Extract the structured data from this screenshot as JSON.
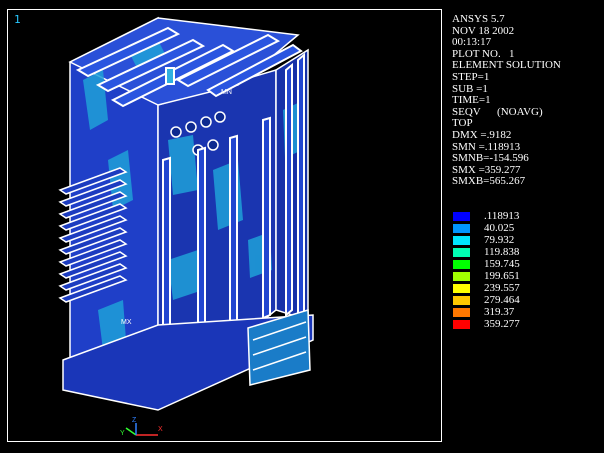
{
  "window_number": "1",
  "info_lines": [
    "ANSYS 5.7",
    "NOV 18 2002",
    "00:13:17",
    "PLOT NO.   1",
    "ELEMENT SOLUTION",
    "STEP=1",
    "SUB =1",
    "TIME=1",
    "SEQV      (NOAVG)",
    "TOP",
    "DMX =.9182",
    "SMN =.118913",
    "SMNB=-154.596",
    "SMX =359.277",
    "SMXB=565.267"
  ],
  "legend": [
    {
      "label": ".118913",
      "color": "#0000ff"
    },
    {
      "label": "40.025",
      "color": "#0096ff"
    },
    {
      "label": "79.932",
      "color": "#00e6ff"
    },
    {
      "label": "119.838",
      "color": "#00ffb4"
    },
    {
      "label": "159.745",
      "color": "#00ff00"
    },
    {
      "label": "199.651",
      "color": "#a0ff00"
    },
    {
      "label": "239.557",
      "color": "#ffff00"
    },
    {
      "label": "279.464",
      "color": "#ffc800"
    },
    {
      "label": "319.37",
      "color": "#ff7800"
    },
    {
      "label": "359.277",
      "color": "#ff0000"
    }
  ],
  "model_labels": {
    "mn": "MN",
    "mx": "MX"
  },
  "triad_labels": {
    "x": "X",
    "y": "Y",
    "z": "Z"
  }
}
